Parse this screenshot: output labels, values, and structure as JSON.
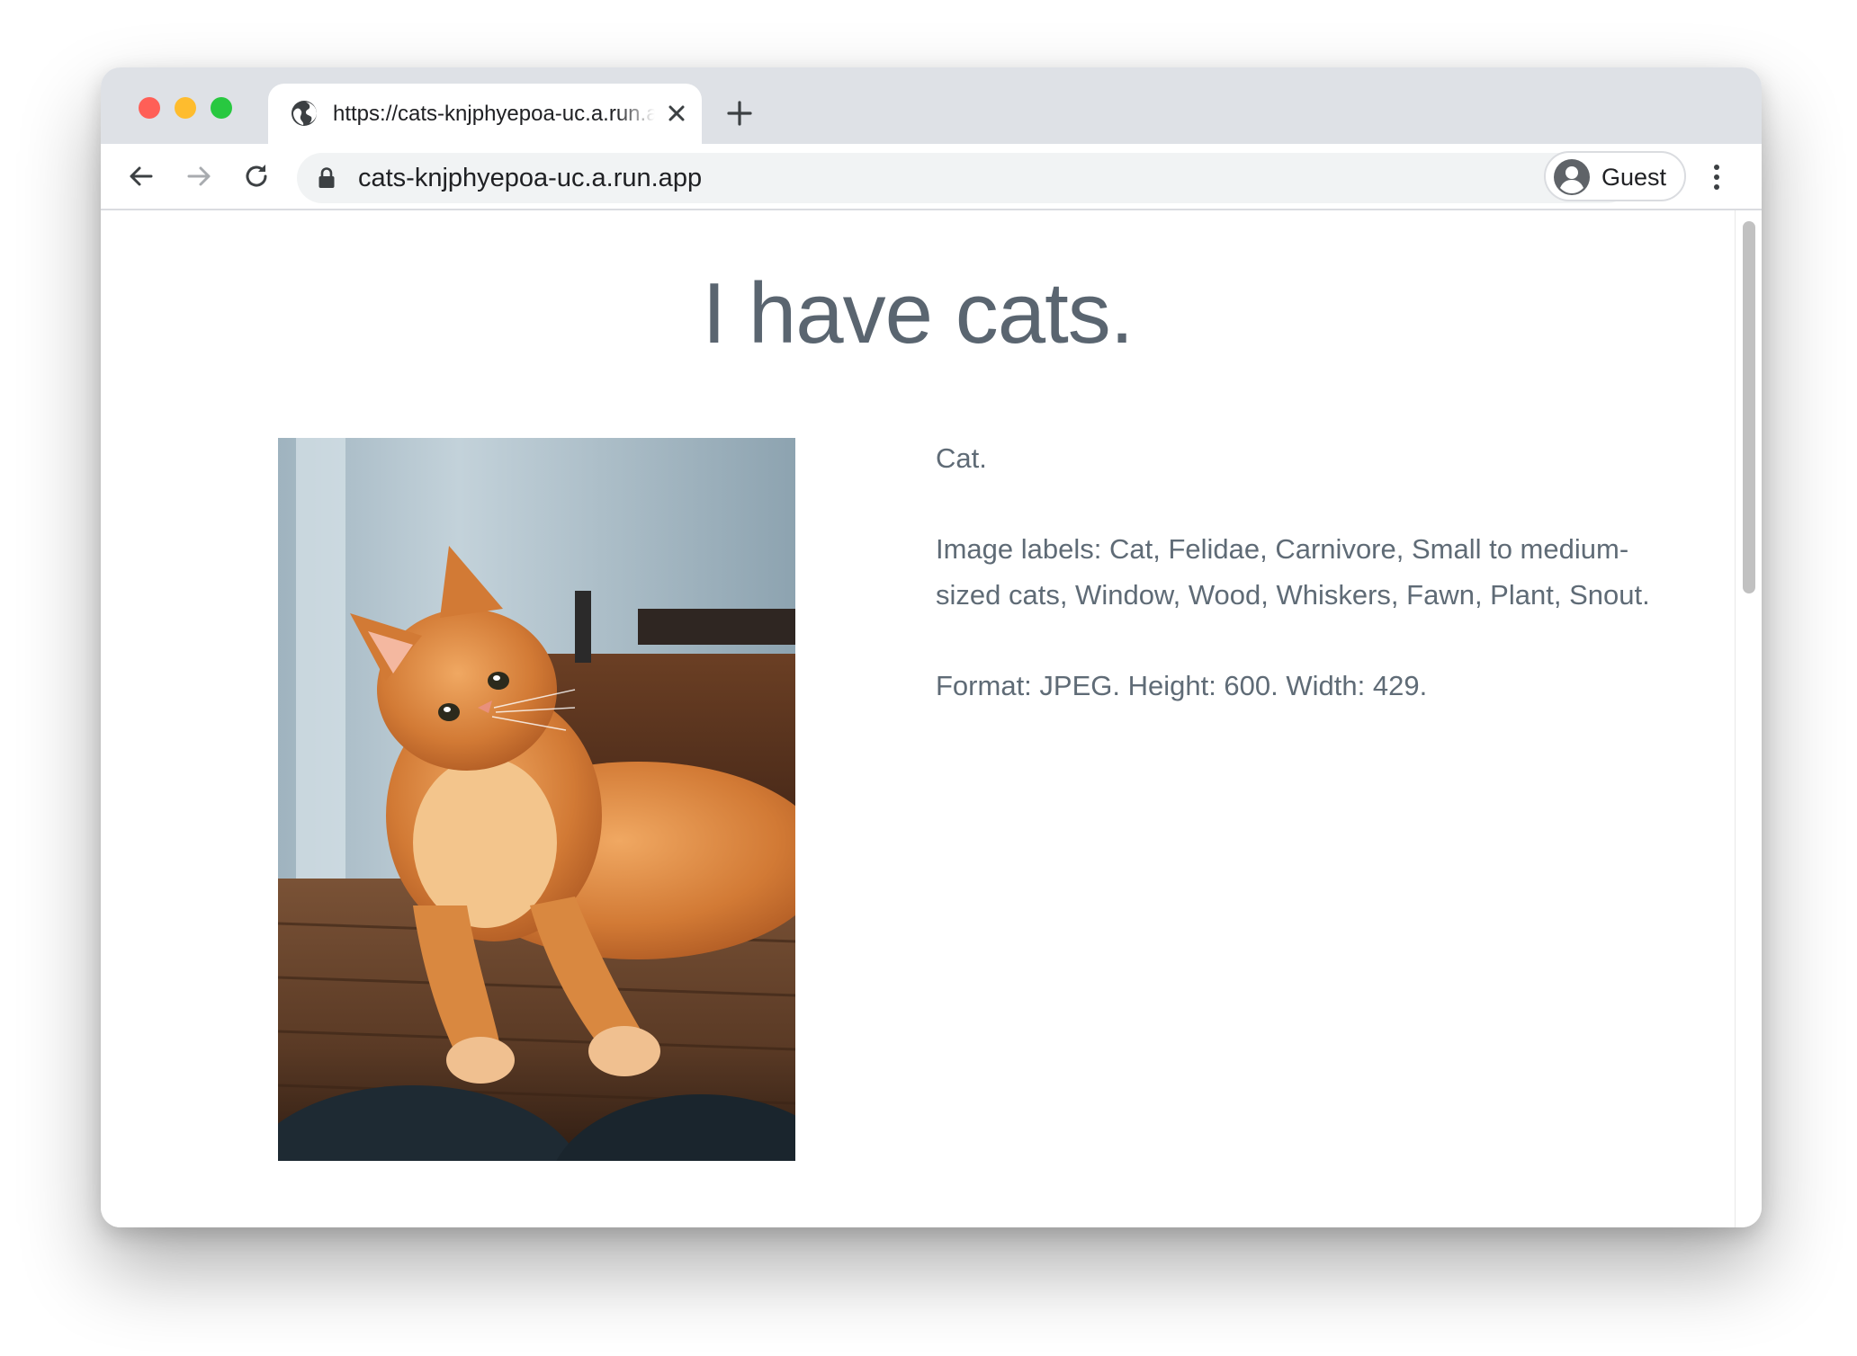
{
  "browser": {
    "tab": {
      "title": "https://cats-knjphyepoa-uc.a.run.app",
      "favicon": "globe-icon",
      "close_icon": "close-icon"
    },
    "new_tab_icon": "plus-icon",
    "toolbar": {
      "back_icon": "back-arrow-icon",
      "forward_icon": "forward-arrow-icon",
      "reload_icon": "reload-icon",
      "lock_icon": "lock-icon",
      "url": "cats-knjphyepoa-uc.a.run.app",
      "profile_name": "Guest",
      "menu_icon": "more-vertical-icon"
    },
    "traffic_lights": {
      "close": "#ff5f57",
      "minimize": "#febc2e",
      "maximize": "#28c840"
    }
  },
  "page": {
    "title": "I have cats.",
    "image_subject": "orange cat lying on a wooden table",
    "caption": "Cat.",
    "labels": "Image labels: Cat, Felidae, Carnivore, Small to medium-sized cats, Window, Wood, Whiskers, Fawn, Plant, Snout.",
    "format": "Format: JPEG. Height: 600. Width: 429."
  },
  "colors": {
    "tabstrip": "#dee1e6",
    "omnibox": "#f1f3f4",
    "page_text": "#5f6b76",
    "title_text": "#5a6570"
  }
}
